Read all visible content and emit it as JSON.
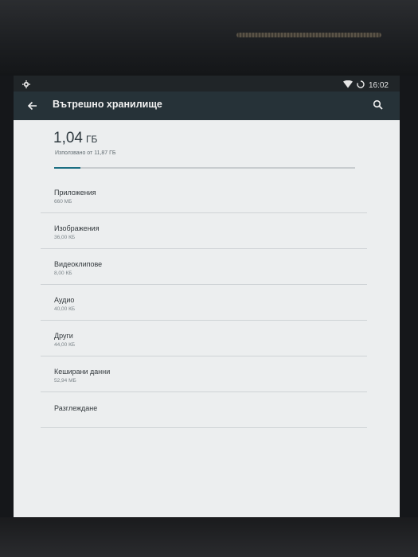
{
  "status_bar": {
    "time": "16:02"
  },
  "toolbar": {
    "title": "Вътрешно хранилище"
  },
  "summary": {
    "used_value": "1,04",
    "used_unit": "ГБ",
    "caption": "Използвано от 11,87 ГБ",
    "used_fraction": 0.088
  },
  "categories": [
    {
      "label": "Приложения",
      "value": "660 МБ"
    },
    {
      "label": "Изображения",
      "value": "36,00 КБ"
    },
    {
      "label": "Видеоклипове",
      "value": "8,00 КБ"
    },
    {
      "label": "Аудио",
      "value": "40,00 КБ"
    },
    {
      "label": "Други",
      "value": "44,00 КБ"
    },
    {
      "label": "Кеширани данни",
      "value": "52,94 МБ"
    }
  ],
  "explore": {
    "label": "Разглеждане"
  },
  "colors": {
    "toolbar": "#263238",
    "status_bar": "#202528",
    "background": "#eceeef",
    "accent": "#1c6f83"
  }
}
